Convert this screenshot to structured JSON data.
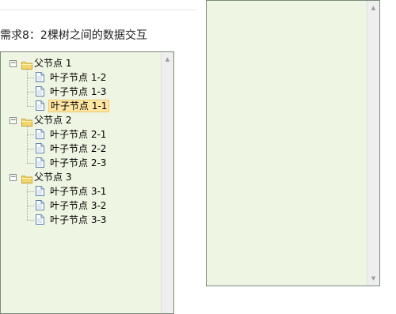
{
  "page": {
    "title": "需求8：2棵树之间的数据交互"
  },
  "left_tree": {
    "nodes": [
      {
        "label": "父节点 1",
        "expanded": true,
        "children": [
          {
            "label": "叶子节点 1-2",
            "selected": false
          },
          {
            "label": "叶子节点 1-3",
            "selected": false
          },
          {
            "label": "叶子节点 1-1",
            "selected": true
          }
        ]
      },
      {
        "label": "父节点 2",
        "expanded": true,
        "children": [
          {
            "label": "叶子节点 2-1",
            "selected": false
          },
          {
            "label": "叶子节点 2-2",
            "selected": false
          },
          {
            "label": "叶子节点 2-3",
            "selected": false
          }
        ]
      },
      {
        "label": "父节点 3",
        "expanded": true,
        "children": [
          {
            "label": "叶子节点 3-1",
            "selected": false
          },
          {
            "label": "叶子节点 3-2",
            "selected": false
          },
          {
            "label": "叶子节点 3-3",
            "selected": false
          }
        ]
      }
    ]
  },
  "right_tree": {
    "nodes": []
  },
  "icons": {
    "collapse": "minus-box-icon",
    "folder": "folder-open-icon",
    "leaf": "document-icon",
    "scroll_up": "scroll-up-arrow-icon",
    "scroll_down": "scroll-down-arrow-icon"
  },
  "colors": {
    "panel_bg": "#eef5e2",
    "panel_border": "#7a8a7a",
    "selected_bg": "#ffe6a3",
    "selected_border": "#f2c56b",
    "folder": "#f5d66a"
  }
}
